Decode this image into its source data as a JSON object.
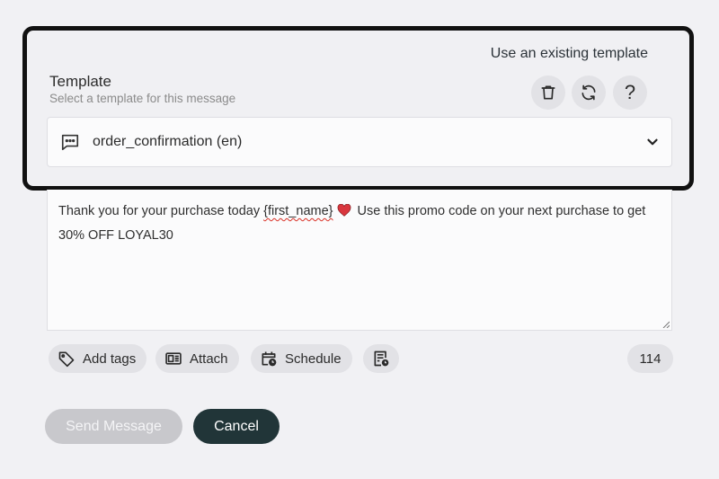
{
  "template": {
    "use_existing_label": "Use an existing template",
    "title": "Template",
    "subtitle": "Select a template for this message",
    "selected_value": "order_confirmation (en)",
    "help_glyph": "?",
    "icons": [
      "trash-icon",
      "refresh-icon",
      "help-icon",
      "message-icon",
      "chevron-down-icon"
    ]
  },
  "message": {
    "text_before": "Thank you for your purchase today ",
    "misspelled_word": "{first_name}",
    "text_after": " Use this promo code on your next purchase to get 30% OFF LOYAL30",
    "emoji": "heart-icon"
  },
  "toolbar": {
    "add_tags_label": "Add tags",
    "attach_label": "Attach",
    "schedule_label": "Schedule",
    "char_count": "114"
  },
  "actions": {
    "send_label": "Send Message",
    "cancel_label": "Cancel"
  },
  "colors": {
    "background": "#f1f1f4",
    "cancel_button": "#213538",
    "send_button_disabled": "#c8c8cc",
    "chip": "#e2e2e6",
    "highlight_border": "#111111"
  }
}
